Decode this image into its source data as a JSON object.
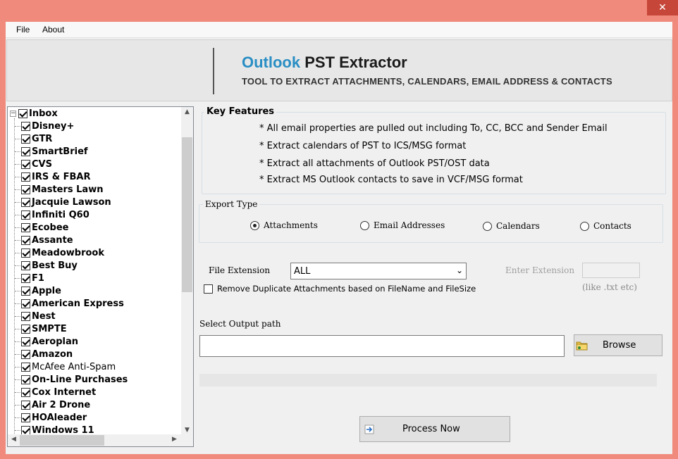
{
  "window": {
    "close_glyph": "✕"
  },
  "menu": [
    "File",
    "About"
  ],
  "banner": {
    "title_part1": "Outlook",
    "title_part2": "PST Extractor",
    "subtitle": "TOOL TO EXTRACT ATTACHMENTS, CALENDARS, EMAIL ADDRESS & CONTACTS"
  },
  "tree": {
    "root": "Inbox",
    "items": [
      {
        "label": "Disney+",
        "bold": true
      },
      {
        "label": "GTR",
        "bold": true
      },
      {
        "label": "SmartBrief",
        "bold": true
      },
      {
        "label": "CVS",
        "bold": true
      },
      {
        "label": "IRS & FBAR",
        "bold": true
      },
      {
        "label": "Masters Lawn",
        "bold": true
      },
      {
        "label": "Jacquie Lawson",
        "bold": true
      },
      {
        "label": "Infiniti Q60",
        "bold": true
      },
      {
        "label": "Ecobee",
        "bold": true
      },
      {
        "label": "Assante",
        "bold": true
      },
      {
        "label": "Meadowbrook",
        "bold": true
      },
      {
        "label": "Best Buy",
        "bold": true
      },
      {
        "label": "F1",
        "bold": true
      },
      {
        "label": "Apple",
        "bold": true
      },
      {
        "label": "American Express",
        "bold": true
      },
      {
        "label": "Nest",
        "bold": true
      },
      {
        "label": "SMPTE",
        "bold": true
      },
      {
        "label": "Aeroplan",
        "bold": true
      },
      {
        "label": "Amazon",
        "bold": true
      },
      {
        "label": "McAfee Anti-Spam",
        "bold": false
      },
      {
        "label": "On-Line Purchases",
        "bold": true
      },
      {
        "label": "Cox Internet",
        "bold": true
      },
      {
        "label": "Air 2 Drone",
        "bold": true
      },
      {
        "label": "HOAleader",
        "bold": true
      },
      {
        "label": "Windows 11",
        "bold": true
      }
    ]
  },
  "key_features": {
    "title": "Key Features",
    "items": [
      "* All email properties are pulled out including To, CC, BCC and Sender Email",
      "* Extract calendars of PST to ICS/MSG format",
      "* Extract all attachments of Outlook PST/OST data",
      "* Extract MS Outlook contacts to save in VCF/MSG format"
    ]
  },
  "export_type": {
    "title": "Export Type",
    "options": [
      "Attachments",
      "Email Addresses",
      "Calendars",
      "Contacts"
    ],
    "selected": "Attachments"
  },
  "file_extension": {
    "label": "File Extension",
    "value": "ALL",
    "enter_label": "Enter Extension",
    "hint": "(like .txt etc)"
  },
  "remove_duplicates": {
    "label": "Remove Duplicate Attachments based  on FileName and FileSize",
    "checked": false
  },
  "output": {
    "label": "Select Output path",
    "value": "",
    "browse_label": "Browse"
  },
  "progress": {
    "fraction": 0
  },
  "process_label": "Process  Now",
  "colors": {
    "accent": "#2a8ec4",
    "window_border": "#f08a7c",
    "close": "#c7463a"
  }
}
